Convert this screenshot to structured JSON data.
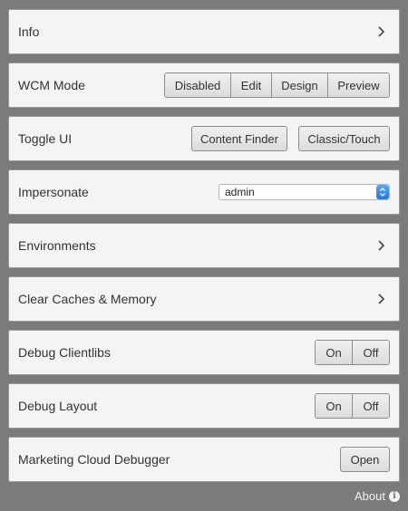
{
  "panels": {
    "info": {
      "label": "Info",
      "icon": "chevron-right-icon"
    },
    "wcm_mode": {
      "label": "WCM Mode",
      "options": [
        "Disabled",
        "Edit",
        "Design",
        "Preview"
      ]
    },
    "toggle_ui": {
      "label": "Toggle UI",
      "buttons": [
        "Content Finder",
        "Classic/Touch"
      ]
    },
    "impersonate": {
      "label": "Impersonate",
      "selected": "admin",
      "icon": "select-arrows-icon"
    },
    "environments": {
      "label": "Environments",
      "icon": "chevron-right-icon"
    },
    "clear_caches": {
      "label": "Clear Caches & Memory",
      "icon": "chevron-right-icon"
    },
    "debug_clientlibs": {
      "label": "Debug Clientlibs",
      "options": [
        "On",
        "Off"
      ]
    },
    "debug_layout": {
      "label": "Debug Layout",
      "options": [
        "On",
        "Off"
      ]
    },
    "marketing_cloud": {
      "label": "Marketing Cloud Debugger",
      "button": "Open"
    }
  },
  "footer": {
    "about_label": "About",
    "icon": "info-icon"
  },
  "colors": {
    "background": "#7b7b7b",
    "panel": "#f4f4f4",
    "select_accent": "#1f76e0"
  }
}
